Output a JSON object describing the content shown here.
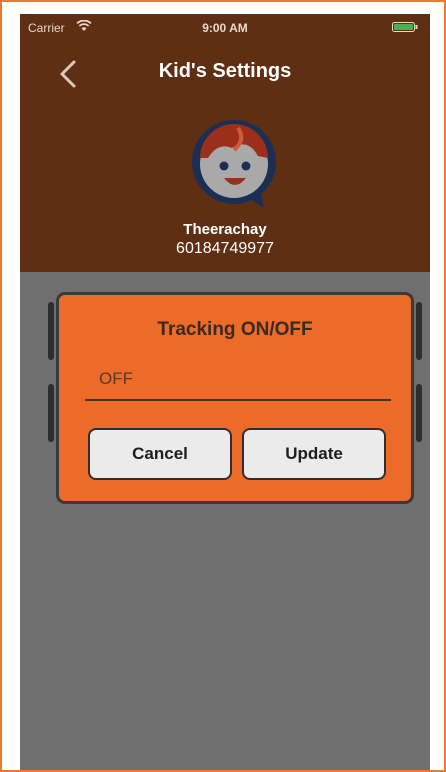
{
  "status_bar": {
    "carrier": "Carrier",
    "time": "9:00 AM"
  },
  "nav": {
    "title": "Kid's Settings",
    "back_icon": "chevron-left-icon"
  },
  "profile": {
    "name": "Theerachay",
    "phone": "60184749977",
    "avatar_icon": "kid-face-chat-icon"
  },
  "dialog": {
    "title": "Tracking ON/OFF",
    "input_value": "OFF",
    "cancel_label": "Cancel",
    "update_label": "Update"
  },
  "colors": {
    "accent": "#ec6b29",
    "header_dimmed": "#5e2f12",
    "overlay": "#6f6f6f"
  }
}
